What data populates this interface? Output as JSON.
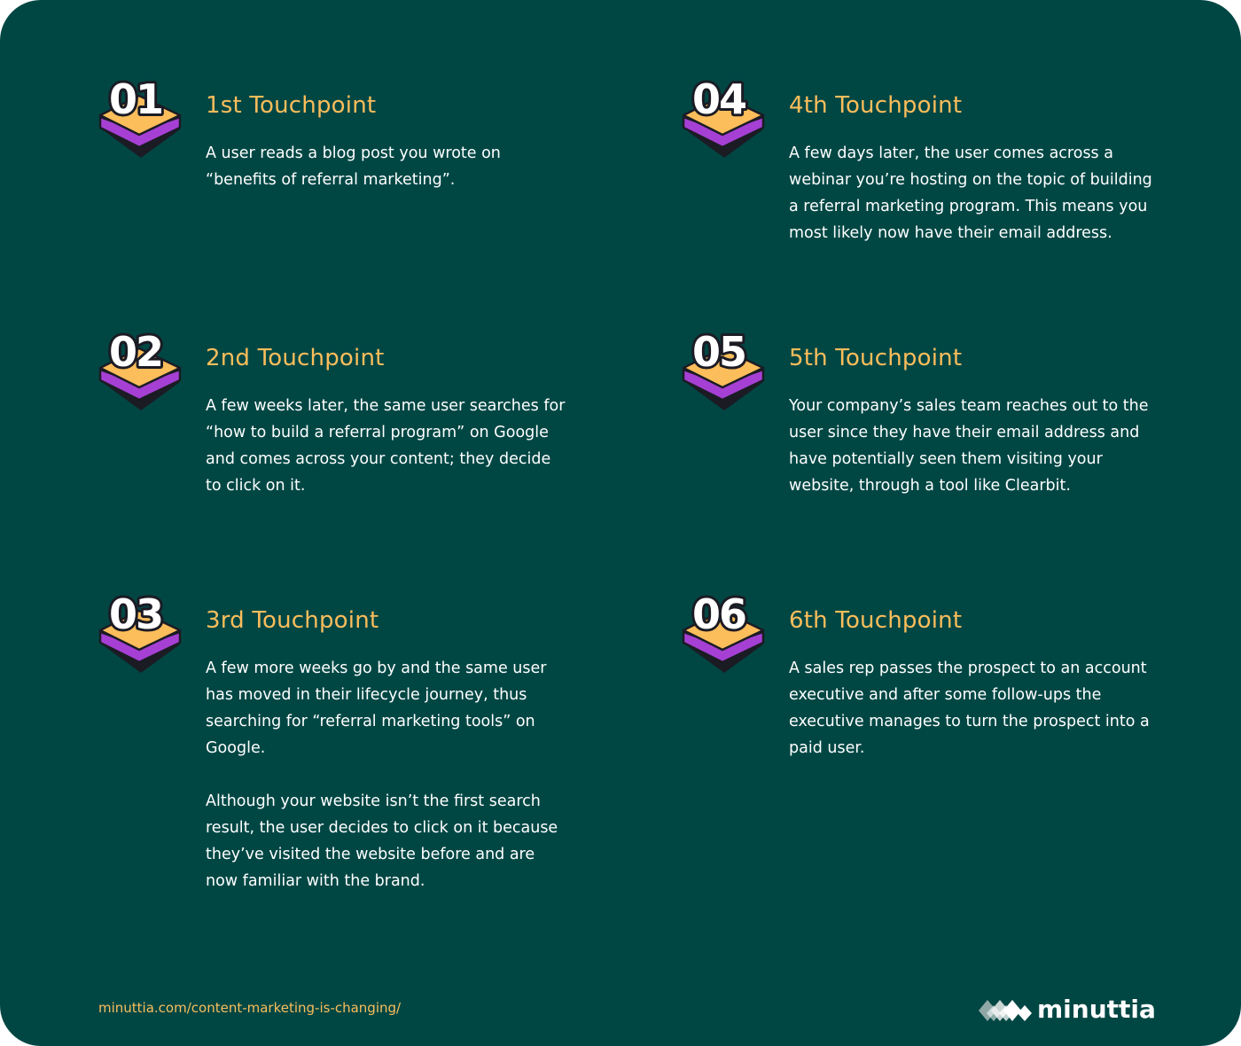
{
  "steps": [
    {
      "number": "01",
      "title": "1st Touchpoint",
      "paragraphs": [
        "A user reads a blog post you wrote on “benefits of referral marketing”."
      ]
    },
    {
      "number": "02",
      "title": "2nd Touchpoint",
      "paragraphs": [
        "A few weeks later, the same user searches for “how to build a referral program” on Google and comes across your content; they decide to click on it."
      ]
    },
    {
      "number": "03",
      "title": "3rd Touchpoint",
      "paragraphs": [
        "A few more weeks go by and the same user has moved in their lifecycle journey, thus searching for “referral marketing tools” on Google.",
        "Although your website isn’t the first search result, the user decides to click on it because they’ve visited the website before and are now familiar with the brand."
      ]
    },
    {
      "number": "04",
      "title": "4th Touchpoint",
      "paragraphs": [
        "A few days later, the user comes across a webinar you’re hosting on the topic of building a referral marketing program. This means you most likely now have their email address."
      ]
    },
    {
      "number": "05",
      "title": "5th Touchpoint",
      "paragraphs": [
        "Your company’s sales team reaches out to the user since they have their email address and have potentially seen them visiting your website, through a tool like Clearbit."
      ]
    },
    {
      "number": "06",
      "title": "6th Touchpoint",
      "paragraphs": [
        "A sales rep passes the prospect to an account executive and after some follow-ups the executive manages to turn the prospect into a paid user."
      ]
    }
  ],
  "footer": {
    "url": "minuttia.com/content-marketing-is-changing/",
    "brand": "minuttia"
  },
  "colors": {
    "background": "#004744",
    "accent": "#fcbd5b",
    "badge_side": "#a640d4",
    "text": "#ffffff"
  }
}
